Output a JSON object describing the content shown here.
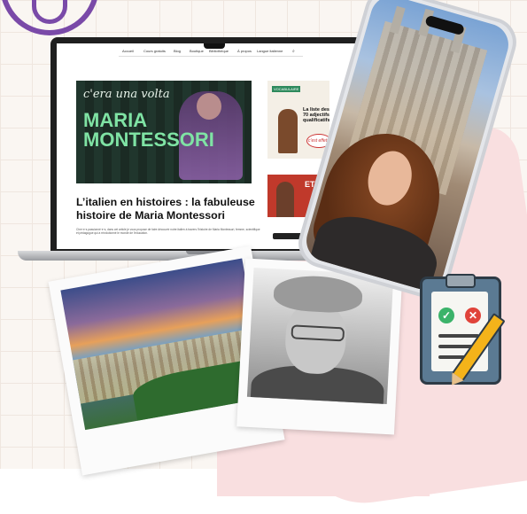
{
  "nav": {
    "items": [
      "Accueil",
      "Cours gratuits",
      "Blog",
      "Boutique",
      "Bibliothèque",
      "À propos",
      "Langue italienne"
    ]
  },
  "hero": {
    "line1": "c'era una volta",
    "name_line1": "MARIA",
    "name_line2": "MONTESSORI"
  },
  "article": {
    "title": "L’italien en histoires : la fabuleuse histoire de Maria Montessori",
    "excerpt": "Cher·e·s passionné·e·s, dans cet article je vous propose de faire découvrir notre italien à travers l'histoire de Maria Montessori, femme, scientifique et pédagogue qui a révolutionné le monde de l'éducation."
  },
  "sidebar": {
    "card1_tag": "VOCABULAIRE",
    "card1_title": "La liste des 70 adjectifs qualificatifs",
    "card1_bubble": "c'est effet !",
    "card2_text": "ET"
  },
  "colors": {
    "accent_green": "#7fe3a4",
    "pink_background": "#f9dfe0",
    "purple_globe": "#7a4aa8"
  },
  "icons": {
    "globe": "globe-icon",
    "clipboard": "clipboard-checklist-icon",
    "check": "check-icon",
    "cross": "cross-icon",
    "pencil": "pencil-icon",
    "search": "search-icon"
  },
  "clipboard": {
    "check_glyph": "✓",
    "cross_glyph": "✕"
  }
}
